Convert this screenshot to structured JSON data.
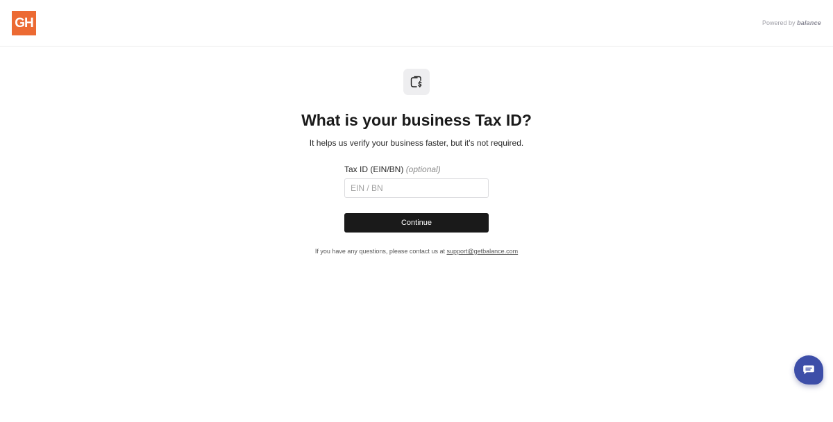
{
  "header": {
    "logo_text": "GH",
    "powered_prefix": "Powered by",
    "powered_brand": "balance"
  },
  "main": {
    "icon": "wallet-dollar-icon",
    "title": "What is your business Tax ID?",
    "subtitle": "It helps us verify your business faster, but it's not required.",
    "field": {
      "label": "Tax ID (EIN/BN)",
      "optional": "(optional)",
      "placeholder": "EIN / BN",
      "value": ""
    },
    "continue_label": "Continue",
    "help_text": "If you have any questions, please contact us at",
    "support_email": "support@getbalance.com"
  },
  "chat": {
    "icon": "chat-icon"
  },
  "colors": {
    "logo_bg": "#ec6a33",
    "button_bg": "#1a1a1a",
    "chat_bg": "#3d4ea8"
  }
}
